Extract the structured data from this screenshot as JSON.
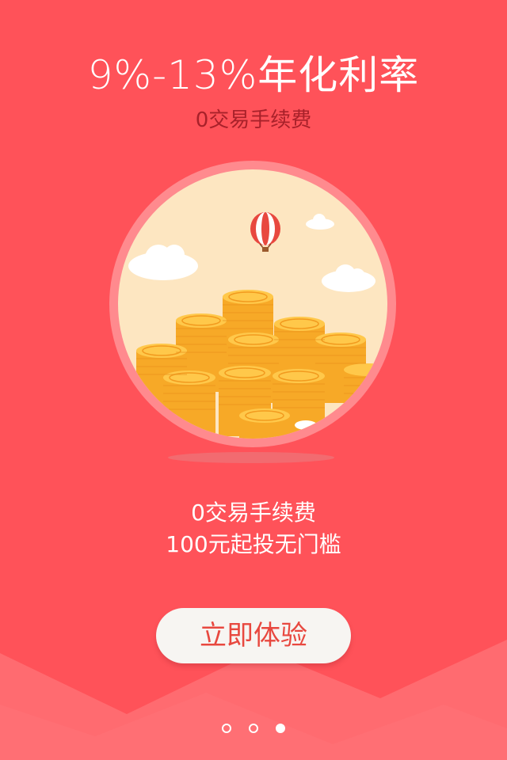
{
  "hero": {
    "headline": "9%-13%年化利率",
    "subheadline": "0交易手续费"
  },
  "features": [
    "0交易手续费",
    "100元起投无门槛"
  ],
  "cta": {
    "label": "立即体验"
  },
  "pager": {
    "total": 3,
    "active_index": 2
  },
  "colors": {
    "background": "#ff5259",
    "mountain": "#ff6b70",
    "subheadline": "#a8212a",
    "button_bg": "#f7f5f2",
    "button_text": "#e8483f",
    "coin": "#f9b233",
    "scene_bg": "#fde6c1"
  },
  "illustration": {
    "icons": [
      "hot-air-balloon-icon",
      "cloud-icon",
      "coin-stack-icon"
    ]
  }
}
